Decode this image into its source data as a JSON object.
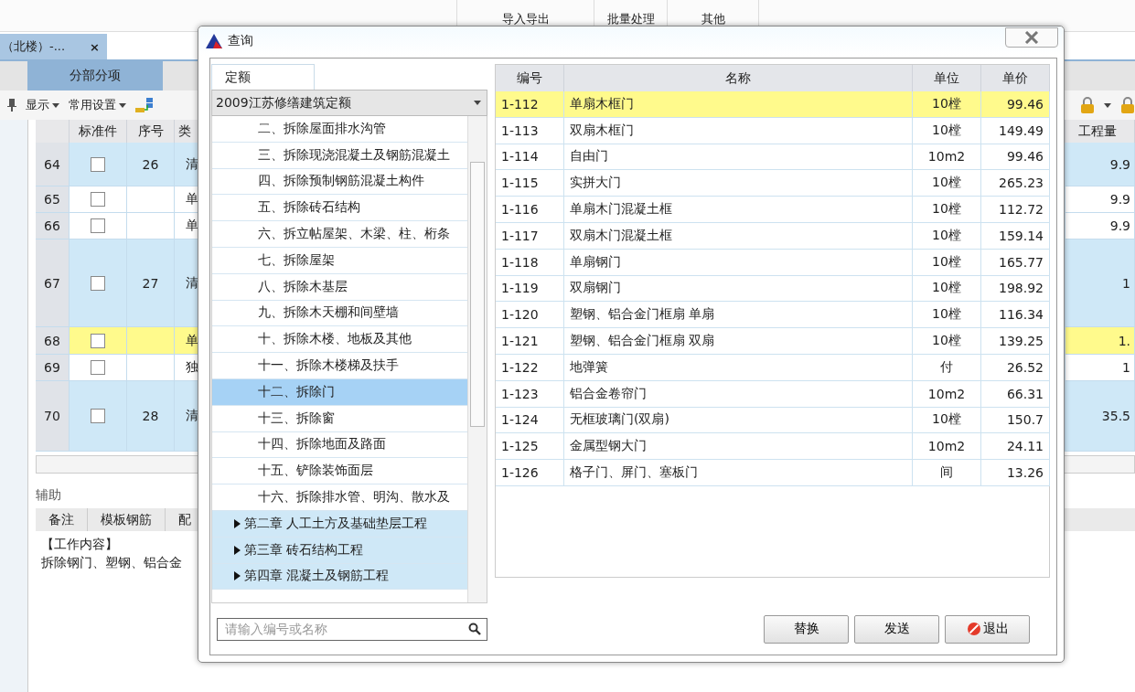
{
  "ribbon": {
    "groups": [
      "导入导出",
      "批量处理",
      "其他"
    ]
  },
  "doc_tab": {
    "title": "（北楼）-...",
    "close": "×"
  },
  "view_tab": {
    "label": "分部分项",
    "selected": true
  },
  "toolbar": {
    "items": [
      "显示",
      "常用设置"
    ]
  },
  "grid": {
    "columns": [
      "标准件",
      "序号",
      "类",
      "工程量"
    ],
    "rows": [
      {
        "num": "64",
        "checked": false,
        "seq": "26",
        "type": "清",
        "qty": "9.9",
        "kind": "bill"
      },
      {
        "num": "65",
        "checked": false,
        "seq": "",
        "type": "单",
        "qty": "9.9",
        "kind": "item"
      },
      {
        "num": "66",
        "checked": false,
        "seq": "",
        "type": "单",
        "qty": "9.9",
        "kind": "item"
      },
      {
        "num": "67",
        "checked": false,
        "seq": "27",
        "type": "清",
        "qty": "1",
        "kind": "bill"
      },
      {
        "num": "68",
        "checked": false,
        "seq": "",
        "type": "单",
        "qty": "1.",
        "kind": "current"
      },
      {
        "num": "69",
        "checked": false,
        "seq": "",
        "type": "独",
        "qty": "1",
        "kind": "item"
      },
      {
        "num": "70",
        "checked": false,
        "seq": "28",
        "type": "清",
        "qty": "35.5",
        "kind": "bill"
      }
    ]
  },
  "aux": {
    "title": "辅助",
    "tabs": [
      "备注",
      "模板钢筋",
      "配"
    ],
    "content": [
      "【工作内容】",
      "拆除钢门、塑钢、铝合金"
    ]
  },
  "dialog": {
    "title": "查询",
    "tabs": [
      {
        "label": "定额",
        "selected": true
      }
    ],
    "library": "2009江苏修缮建筑定额",
    "tree": [
      {
        "label": "二、拆除屋面排水沟管",
        "selected": false
      },
      {
        "label": "三、拆除现浇混凝土及钢筋混凝土",
        "selected": false
      },
      {
        "label": "四、拆除预制钢筋混凝土构件",
        "selected": false
      },
      {
        "label": "五、拆除砖石结构",
        "selected": false
      },
      {
        "label": "六、拆立帖屋架、木梁、柱、桁条",
        "selected": false
      },
      {
        "label": "七、拆除屋架",
        "selected": false
      },
      {
        "label": "八、拆除木基层",
        "selected": false
      },
      {
        "label": "九、拆除木天棚和间壁墙",
        "selected": false
      },
      {
        "label": "十、拆除木楼、地板及其他",
        "selected": false
      },
      {
        "label": "十一、拆除木楼梯及扶手",
        "selected": false
      },
      {
        "label": "十二、拆除门",
        "selected": true
      },
      {
        "label": "十三、拆除窗",
        "selected": false
      },
      {
        "label": "十四、拆除地面及路面",
        "selected": false
      },
      {
        "label": "十五、铲除装饰面层",
        "selected": false
      },
      {
        "label": "十六、拆除排水管、明沟、散水及",
        "selected": false
      },
      {
        "label": "第二章 人工土方及基础垫层工程",
        "selected": false,
        "expanded": false,
        "kind": "chapter"
      },
      {
        "label": "第三章  砖石结构工程",
        "selected": false,
        "expanded": false,
        "kind": "chapter"
      },
      {
        "label": "第四章 混凝土及钢筋工程",
        "selected": false,
        "expanded": false,
        "kind": "chapter"
      }
    ],
    "columns": [
      "编号",
      "名称",
      "单位",
      "单价"
    ],
    "rows": [
      {
        "code": "1-112",
        "name": "单扇木框门",
        "unit": "10樘",
        "price": "99.46",
        "selected": true
      },
      {
        "code": "1-113",
        "name": "双扇木框门",
        "unit": "10樘",
        "price": "149.49",
        "selected": false
      },
      {
        "code": "1-114",
        "name": "自由门",
        "unit": "10m2",
        "price": "99.46",
        "selected": false
      },
      {
        "code": "1-115",
        "name": "实拼大门",
        "unit": "10樘",
        "price": "265.23",
        "selected": false
      },
      {
        "code": "1-116",
        "name": "单扇木门混凝土框",
        "unit": "10樘",
        "price": "112.72",
        "selected": false
      },
      {
        "code": "1-117",
        "name": "双扇木门混凝土框",
        "unit": "10樘",
        "price": "159.14",
        "selected": false
      },
      {
        "code": "1-118",
        "name": "单扇钢门",
        "unit": "10樘",
        "price": "165.77",
        "selected": false
      },
      {
        "code": "1-119",
        "name": "双扇钢门",
        "unit": "10樘",
        "price": "198.92",
        "selected": false
      },
      {
        "code": "1-120",
        "name": "塑钢、铝合金门框扇 单扇",
        "unit": "10樘",
        "price": "116.34",
        "selected": false
      },
      {
        "code": "1-121",
        "name": "塑钢、铝合金门框扇 双扇",
        "unit": "10樘",
        "price": "139.25",
        "selected": false
      },
      {
        "code": "1-122",
        "name": "地弹簧",
        "unit": "付",
        "price": "26.52",
        "selected": false
      },
      {
        "code": "1-123",
        "name": "铝合金卷帘门",
        "unit": "10m2",
        "price": "66.31",
        "selected": false
      },
      {
        "code": "1-124",
        "name": "无框玻璃门(双扇)",
        "unit": "10樘",
        "price": "150.7",
        "selected": false
      },
      {
        "code": "1-125",
        "name": "金属型钢大门",
        "unit": "10m2",
        "price": "24.11",
        "selected": false
      },
      {
        "code": "1-126",
        "name": "格子门、屏门、塞板门",
        "unit": "间",
        "price": "13.26",
        "selected": false
      }
    ],
    "search": {
      "placeholder": "请输入编号或名称"
    },
    "buttons": [
      {
        "label": "替换",
        "kind": "plain"
      },
      {
        "label": "发送",
        "kind": "plain"
      },
      {
        "label": "退出",
        "kind": "exit"
      }
    ]
  }
}
